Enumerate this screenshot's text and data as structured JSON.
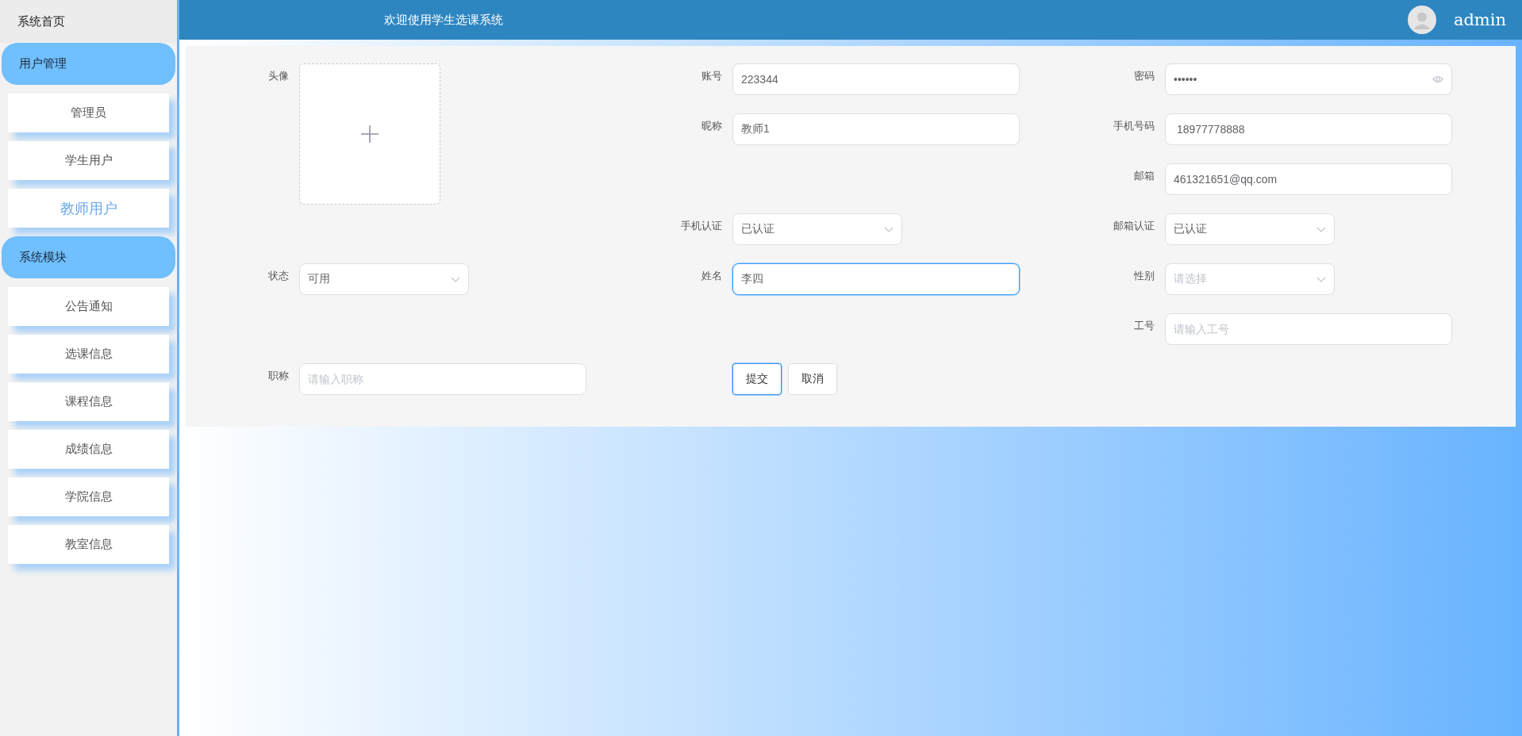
{
  "sidebar": {
    "home": "系统首页",
    "groups": [
      {
        "title": "用户管理",
        "items": [
          {
            "label": "管理员",
            "selected": false
          },
          {
            "label": "学生用户",
            "selected": false
          },
          {
            "label": "教师用户",
            "selected": true
          }
        ]
      },
      {
        "title": "系统模块",
        "items": [
          {
            "label": "公告通知",
            "selected": false
          },
          {
            "label": "选课信息",
            "selected": false
          },
          {
            "label": "课程信息",
            "selected": false
          },
          {
            "label": "成绩信息",
            "selected": false
          },
          {
            "label": "学院信息",
            "selected": false
          },
          {
            "label": "教室信息",
            "selected": false
          }
        ]
      }
    ]
  },
  "header": {
    "title": "欢迎使用学生选课系统",
    "user": "admin"
  },
  "form": {
    "fields": [
      {
        "label": "头像",
        "kind": "upload"
      },
      {
        "label": "账号",
        "kind": "text",
        "value": "223344",
        "focused": false
      },
      {
        "label": "密码",
        "kind": "password",
        "value": "••••••",
        "focused": false
      },
      {
        "label": "昵称",
        "kind": "text",
        "value": "教师1",
        "focused": false
      },
      {
        "label": "手机号码",
        "kind": "text",
        "value": " 18977778888",
        "focused": false
      },
      {
        "label": "邮箱",
        "kind": "text",
        "value": "461321651@qq.com",
        "focused": false
      },
      {
        "label": "手机认证",
        "kind": "select",
        "value": "已认证",
        "focused": false
      },
      {
        "label": "邮箱认证",
        "kind": "select",
        "value": "已认证",
        "focused": false
      },
      {
        "label": "状态",
        "kind": "select",
        "value": "可用",
        "focused": false
      },
      {
        "label": "姓名",
        "kind": "text",
        "value": "李四",
        "focused": true
      },
      {
        "label": "性别",
        "kind": "select",
        "placeholder": "请选择",
        "focused": false
      },
      {
        "label": "工号",
        "kind": "text",
        "placeholder": "请输入工号",
        "focused": false
      },
      {
        "label": "职称",
        "kind": "text",
        "placeholder": "请输入职称",
        "focused": false
      }
    ],
    "buttons": [
      {
        "label": "提交",
        "focused": true
      },
      {
        "label": "取消",
        "focused": false
      }
    ]
  }
}
